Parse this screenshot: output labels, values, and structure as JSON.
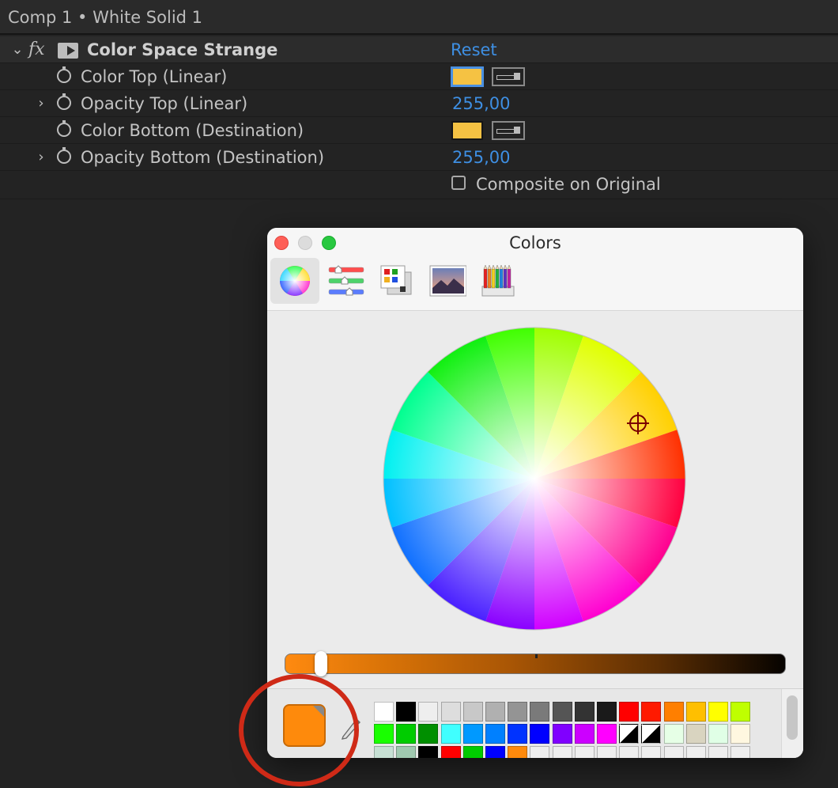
{
  "comp_title": "Comp 1 • White Solid 1",
  "effect": {
    "name": "Color Space Strange",
    "reset_label": "Reset",
    "properties": [
      {
        "label": "Color Top (Linear)",
        "type": "color",
        "color": "#F5C243"
      },
      {
        "label": "Opacity Top (Linear)",
        "type": "number",
        "value": "255,00"
      },
      {
        "label": "Color Bottom (Destination)",
        "type": "color",
        "color": "#F5C243"
      },
      {
        "label": "Opacity Bottom (Destination)",
        "type": "number",
        "value": "255,00"
      }
    ],
    "composite_label": "Composite on Original"
  },
  "colors_panel": {
    "title": "Colors",
    "toolbar": [
      "color-wheel",
      "color-sliders",
      "color-palettes",
      "image-palettes",
      "pencils"
    ],
    "current_color": "#FE8A0C",
    "swatches": [
      [
        "#FFFFFF",
        "#000000",
        "#EEEEEE",
        "#DDDDDD",
        "#C8C8C8",
        "#B0B0B0",
        "#949494",
        "#7A7A7A",
        "#555555",
        "#333333",
        "#1A1A1A",
        "#FF0000",
        "#FF1A00",
        "#FF7F00",
        "#FFBF00",
        "#FFFF00",
        "#BFFF00"
      ],
      [
        "#19FF00",
        "#00CC00",
        "#008F00",
        "#40FFFF",
        "#0099FF",
        "#0080FF",
        "#0033FF",
        "#0000FF",
        "#8000FF",
        "#CC00FF",
        "#FF00FF",
        "diag",
        "diag",
        "#E6FFE6",
        "#D9D4C0",
        "#E0FFE6",
        "#FFF7E0"
      ],
      [
        "#C7E0D4",
        "#A0C9B0",
        "#000000",
        "#FF0000",
        "#00CC00",
        "#0000FF",
        "#FF8A0C",
        "#EEEEEE",
        "#EEEEEE",
        "#EEEEEE",
        "#EEEEEE",
        "#EEEEEE",
        "#EEEEEE",
        "#EEEEEE",
        "#EEEEEE",
        "#EEEEEE",
        "#EEEEEE"
      ]
    ],
    "highlight_ring_color": "#CF2A17"
  }
}
